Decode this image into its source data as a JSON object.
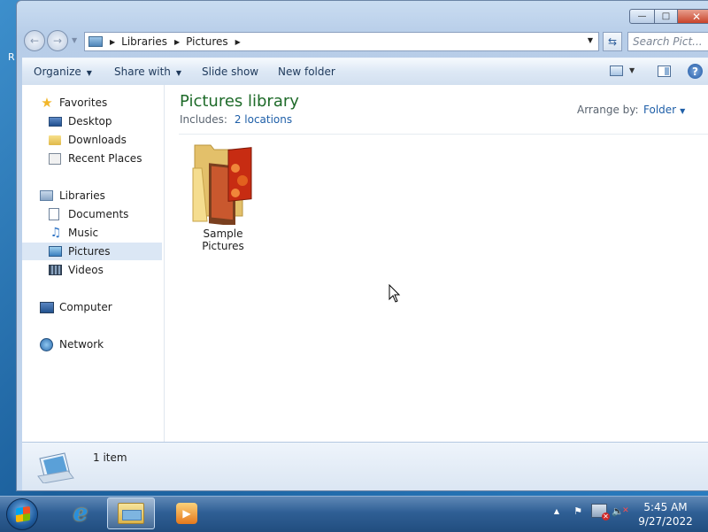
{
  "desktop": {
    "edge_text": "R"
  },
  "window": {
    "caption_buttons": {
      "minimize": "—",
      "maximize": "□",
      "close": "✕"
    },
    "nav": {
      "back_icon": "back-arrow-icon",
      "forward_icon": "forward-arrow-icon",
      "breadcrumb": [
        "Libraries",
        "Pictures"
      ],
      "search_placeholder": "Search Pict..."
    },
    "command_bar": {
      "organize": "Organize",
      "share_with": "Share with",
      "slide_show": "Slide show",
      "new_folder": "New folder"
    },
    "navigation_pane": {
      "favorites": {
        "label": "Favorites",
        "items": [
          "Desktop",
          "Downloads",
          "Recent Places"
        ]
      },
      "libraries": {
        "label": "Libraries",
        "items": [
          "Documents",
          "Music",
          "Pictures",
          "Videos"
        ],
        "selected": "Pictures"
      },
      "computer": "Computer",
      "network": "Network"
    },
    "content": {
      "title": "Pictures library",
      "includes_label": "Includes:",
      "includes_link": "2 locations",
      "arrange_label": "Arrange by:",
      "arrange_value": "Folder",
      "items": [
        {
          "name": "Sample Pictures",
          "type": "folder"
        }
      ]
    },
    "details": {
      "count": "1 item"
    }
  },
  "taskbar": {
    "clock_time": "5:45 AM",
    "clock_date": "9/27/2022",
    "pinned": [
      "internet-explorer",
      "windows-explorer",
      "windows-media-player"
    ]
  },
  "colors": {
    "library_title": "#1f6b2a",
    "link": "#1f5fa8",
    "selection": "#dbe7f5",
    "taskbar": "#2f5f95"
  }
}
